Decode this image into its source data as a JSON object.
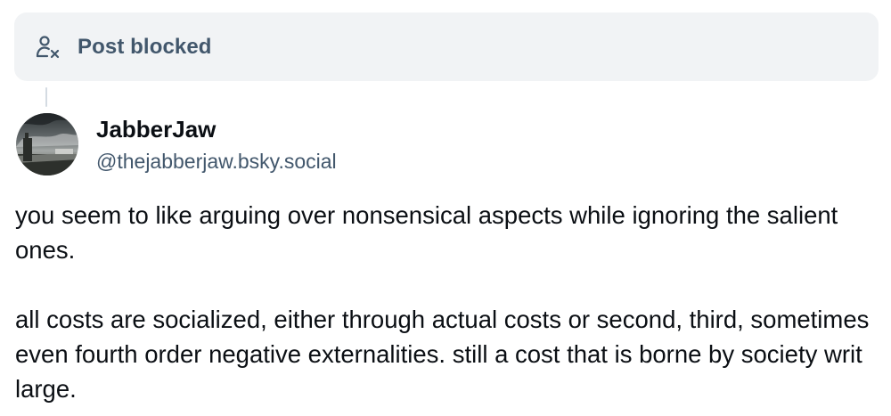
{
  "blocked_notice": {
    "icon": "person-x-icon",
    "label": "Post blocked"
  },
  "author": {
    "display_name": "JabberJaw",
    "handle": "@thejabberjaw.bsky.social",
    "avatar": "avatar"
  },
  "post": {
    "paragraphs": [
      "you seem to like arguing over nonsensical aspects while ignoring the salient ones.",
      "all costs are socialized, either through actual costs or second, third, sometimes even fourth order negative externalities. still a cost that is borne by society writ large."
    ]
  },
  "colors": {
    "banner_bg": "#f1f3f5",
    "muted_text": "#42576c",
    "text": "#0b0f14",
    "thread_line": "#d4dbe2"
  }
}
